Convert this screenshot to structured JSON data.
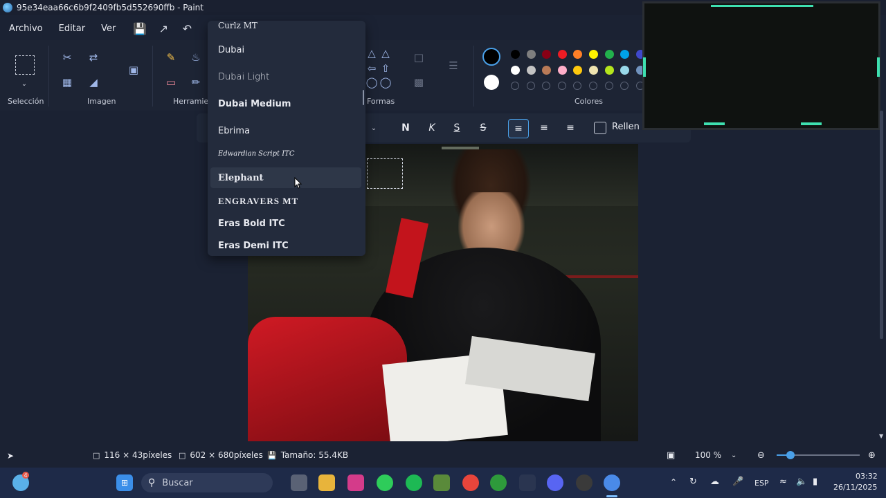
{
  "window": {
    "title": "95e34eaa66c6b9f2409fb5d552690ffb - Paint"
  },
  "menu": {
    "file": "Archivo",
    "edit": "Editar",
    "view": "Ver"
  },
  "ribbon": {
    "selection_label": "Selección",
    "image_label": "Imagen",
    "tools_label": "Herramien",
    "shapes_label": "Formas",
    "colors_label": "Colores"
  },
  "font_dropdown": {
    "items": [
      {
        "name": "Curlz MT",
        "state": "partial"
      },
      {
        "name": "Dubai"
      },
      {
        "name": "Dubai Light"
      },
      {
        "name": "Dubai Medium"
      },
      {
        "name": "Ebrima"
      },
      {
        "name": "Edwardian Script ITC"
      },
      {
        "name": "Elephant",
        "state": "hover"
      },
      {
        "name": "ENGRAVERS MT"
      },
      {
        "name": "Eras Bold ITC"
      },
      {
        "name": "Eras Demi ITC"
      }
    ]
  },
  "text_toolbar": {
    "bold": "N",
    "italic": "K",
    "underline": "S",
    "strike": "S",
    "fill_label": "Rellen"
  },
  "palette": {
    "primary": "#000000",
    "secondary": "#ffffff",
    "row1": [
      "#000000",
      "#7f7f7f",
      "#880015",
      "#ed1c24",
      "#ff7f27",
      "#fff200",
      "#22b14c",
      "#00a2e8",
      "#3f48cc"
    ],
    "row2": [
      "#ffffff",
      "#c3c3c3",
      "#b97a57",
      "#ffaec9",
      "#ffc90e",
      "#efe4b0",
      "#b5e61d",
      "#99d9ea",
      "#7092be"
    ]
  },
  "status": {
    "selection_size": "116 × 43píxeles",
    "canvas_size": "602 × 680píxeles",
    "file_size": "Tamaño: 55.4KB",
    "zoom": "100 %"
  },
  "taskbar": {
    "search_placeholder": "Buscar",
    "weather_badge": "4",
    "language": "ESP",
    "time": "03:32",
    "date": "26/11/2025"
  }
}
